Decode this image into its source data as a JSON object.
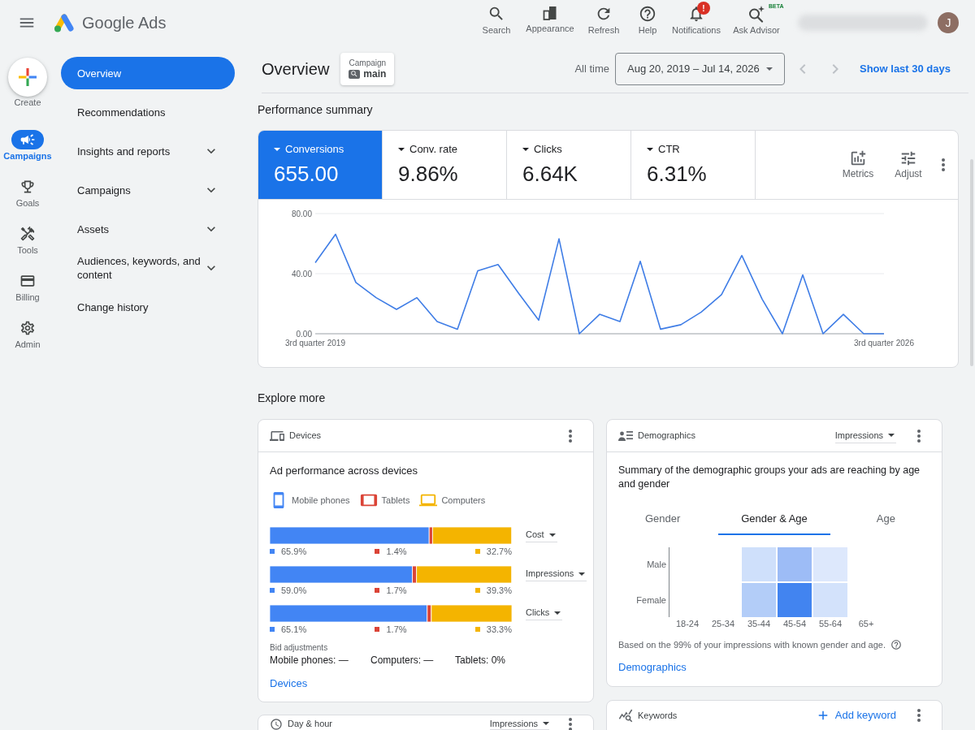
{
  "top_bar": {
    "product_name": "Google Ads",
    "actions": [
      {
        "label": "Search"
      },
      {
        "label": "Appearance"
      },
      {
        "label": "Refresh"
      },
      {
        "label": "Help"
      },
      {
        "label": "Notifications",
        "badge": "!"
      },
      {
        "label": "Ask Advisor",
        "tag": "BETA"
      }
    ],
    "avatar_initial": "J"
  },
  "rail": {
    "create_label": "Create",
    "items": [
      {
        "label": "Campaigns",
        "selected": true
      },
      {
        "label": "Goals",
        "selected": false
      },
      {
        "label": "Tools",
        "selected": false
      },
      {
        "label": "Billing",
        "selected": false
      },
      {
        "label": "Admin",
        "selected": false
      }
    ]
  },
  "nav": {
    "items": [
      {
        "label": "Overview",
        "selected": true,
        "kind": "link"
      },
      {
        "label": "Recommendations",
        "selected": false,
        "kind": "link"
      },
      {
        "label": "Insights and reports",
        "selected": false,
        "kind": "group"
      },
      {
        "label": "Campaigns",
        "selected": false,
        "kind": "group"
      },
      {
        "label": "Assets",
        "selected": false,
        "kind": "group"
      },
      {
        "label": "Audiences, keywords, and content",
        "selected": false,
        "kind": "group"
      },
      {
        "label": "Change history",
        "selected": false,
        "kind": "link"
      }
    ]
  },
  "header": {
    "title": "Overview",
    "campaign_filter": {
      "label": "Campaign",
      "value": "main"
    },
    "range_label": "All time",
    "date_range": "Aug 20, 2019 – Jul 14, 2026",
    "show_last_link": "Show last 30 days"
  },
  "performance": {
    "title": "Performance summary",
    "metrics": [
      {
        "label": "Conversions",
        "value": "655.00",
        "selected": true
      },
      {
        "label": "Conv. rate",
        "value": "9.86%",
        "selected": false
      },
      {
        "label": "Clicks",
        "value": "6.64K",
        "selected": false
      },
      {
        "label": "CTR",
        "value": "6.31%",
        "selected": false
      }
    ],
    "tools": [
      {
        "label": "Metrics"
      },
      {
        "label": "Adjust"
      }
    ],
    "chart_data": {
      "type": "line",
      "categories": [
        "3rd quarter 2019",
        null,
        null,
        null,
        null,
        null,
        null,
        null,
        null,
        null,
        null,
        null,
        null,
        null,
        null,
        null,
        null,
        null,
        null,
        null,
        null,
        null,
        null,
        null,
        null,
        null,
        null,
        null,
        "3rd quarter 2026"
      ],
      "ylim": [
        0,
        80
      ],
      "yticks": [
        {
          "value": 0,
          "label": "0.00"
        },
        {
          "value": 40,
          "label": "40.00"
        },
        {
          "value": 80,
          "label": "80.00"
        }
      ],
      "series": [
        {
          "color": "#3f7de6",
          "values": [
            47.3,
            66.2,
            34.1,
            24.0,
            16.2,
            24.0,
            8.1,
            3.0,
            41.9,
            46.1,
            27.2,
            9.0,
            63.2,
            0,
            12.9,
            8.1,
            48.2,
            3.0,
            6.0,
            14.4,
            26.0,
            52.1,
            23.1,
            0,
            39.2,
            0,
            12.9,
            0,
            0
          ]
        }
      ]
    }
  },
  "explore": {
    "title": "Explore more",
    "devices": {
      "title": "Devices",
      "subtitle": "Ad performance across devices",
      "chart_data": {
        "type": "bar",
        "orientation": "horizontal",
        "stacked": true,
        "legend": "top",
        "categories": [
          "Cost",
          "Impressions",
          "Clicks"
        ],
        "series": [
          {
            "name": "Mobile phones",
            "color": "#4285f4",
            "values": [
              65.9,
              59.0,
              65.1
            ],
            "value_labels": [
              "65.9%",
              "59.0%",
              "65.1%"
            ]
          },
          {
            "name": "Tablets",
            "color": "#db4437",
            "values": [
              1.4,
              1.7,
              1.7
            ],
            "value_labels": [
              "1.4%",
              "1.7%",
              "1.7%"
            ]
          },
          {
            "name": "Computers",
            "color": "#f4b400",
            "values": [
              32.7,
              39.3,
              33.3
            ],
            "value_labels": [
              "32.7%",
              "39.3%",
              "33.3%"
            ]
          }
        ]
      },
      "bid_adjustments": {
        "title": "Bid adjustments",
        "items": [
          "Mobile phones: —",
          "Computers: —",
          "Tablets: 0%"
        ]
      },
      "link": "Devices"
    },
    "demographics": {
      "title": "Demographics",
      "metric": "Impressions",
      "summary": "Summary of the demographic groups your ads are reaching by age and gender",
      "tabs": [
        {
          "label": "Gender",
          "selected": false
        },
        {
          "label": "Gender & Age",
          "selected": true
        },
        {
          "label": "Age",
          "selected": false
        }
      ],
      "heatmap": {
        "rows": [
          {
            "label": "Male",
            "cells": [
              {
                "shaded": false
              },
              {
                "shaded": false
              },
              {
                "shaded": true,
                "color": "#cfe0fb"
              },
              {
                "shaded": true,
                "color": "#9dbcf6"
              },
              {
                "shaded": true,
                "color": "#dde8fc"
              },
              {
                "shaded": false
              }
            ]
          },
          {
            "label": "Female",
            "cells": [
              {
                "shaded": false
              },
              {
                "shaded": false
              },
              {
                "shaded": true,
                "color": "#b3cdf8"
              },
              {
                "shaded": true,
                "color": "#4284f0"
              },
              {
                "shaded": true,
                "color": "#d3e2fb"
              },
              {
                "shaded": false
              }
            ]
          }
        ],
        "columns": [
          "18-24",
          "25-34",
          "35-44",
          "45-54",
          "55-64",
          "65+"
        ]
      },
      "footnote": "Based on the 99% of your impressions with known gender and age.",
      "link": "Demographics"
    },
    "day_hour": {
      "title": "Day & hour",
      "metric": "Impressions"
    },
    "keywords": {
      "title": "Keywords",
      "action": "Add keyword"
    }
  }
}
